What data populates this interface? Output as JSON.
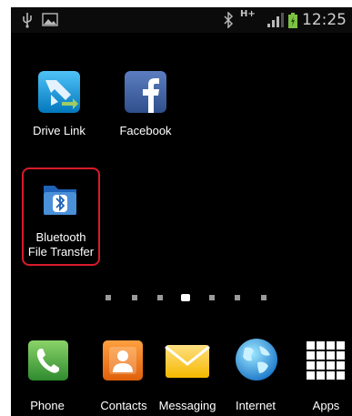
{
  "status_bar": {
    "time": "12:25",
    "network": "H+",
    "icons": [
      "usb-icon",
      "gallery-icon",
      "bluetooth-icon",
      "signal-icon",
      "battery-icon"
    ]
  },
  "home_apps": [
    {
      "label": "Drive Link"
    },
    {
      "label": "Facebook"
    },
    {
      "label_line1": "Bluetooth",
      "label_line2": "File Transfer"
    }
  ],
  "page_indicator": {
    "pages": 7,
    "current": 4
  },
  "dock": [
    {
      "label": "Phone"
    },
    {
      "label": "Contacts"
    },
    {
      "label": "Messaging"
    },
    {
      "label": "Internet"
    },
    {
      "label": "Apps"
    }
  ],
  "colors": {
    "highlight": "#d81b2a",
    "phone": "#4caf50",
    "contacts": "#f57c00",
    "facebook": "#3b5998"
  }
}
